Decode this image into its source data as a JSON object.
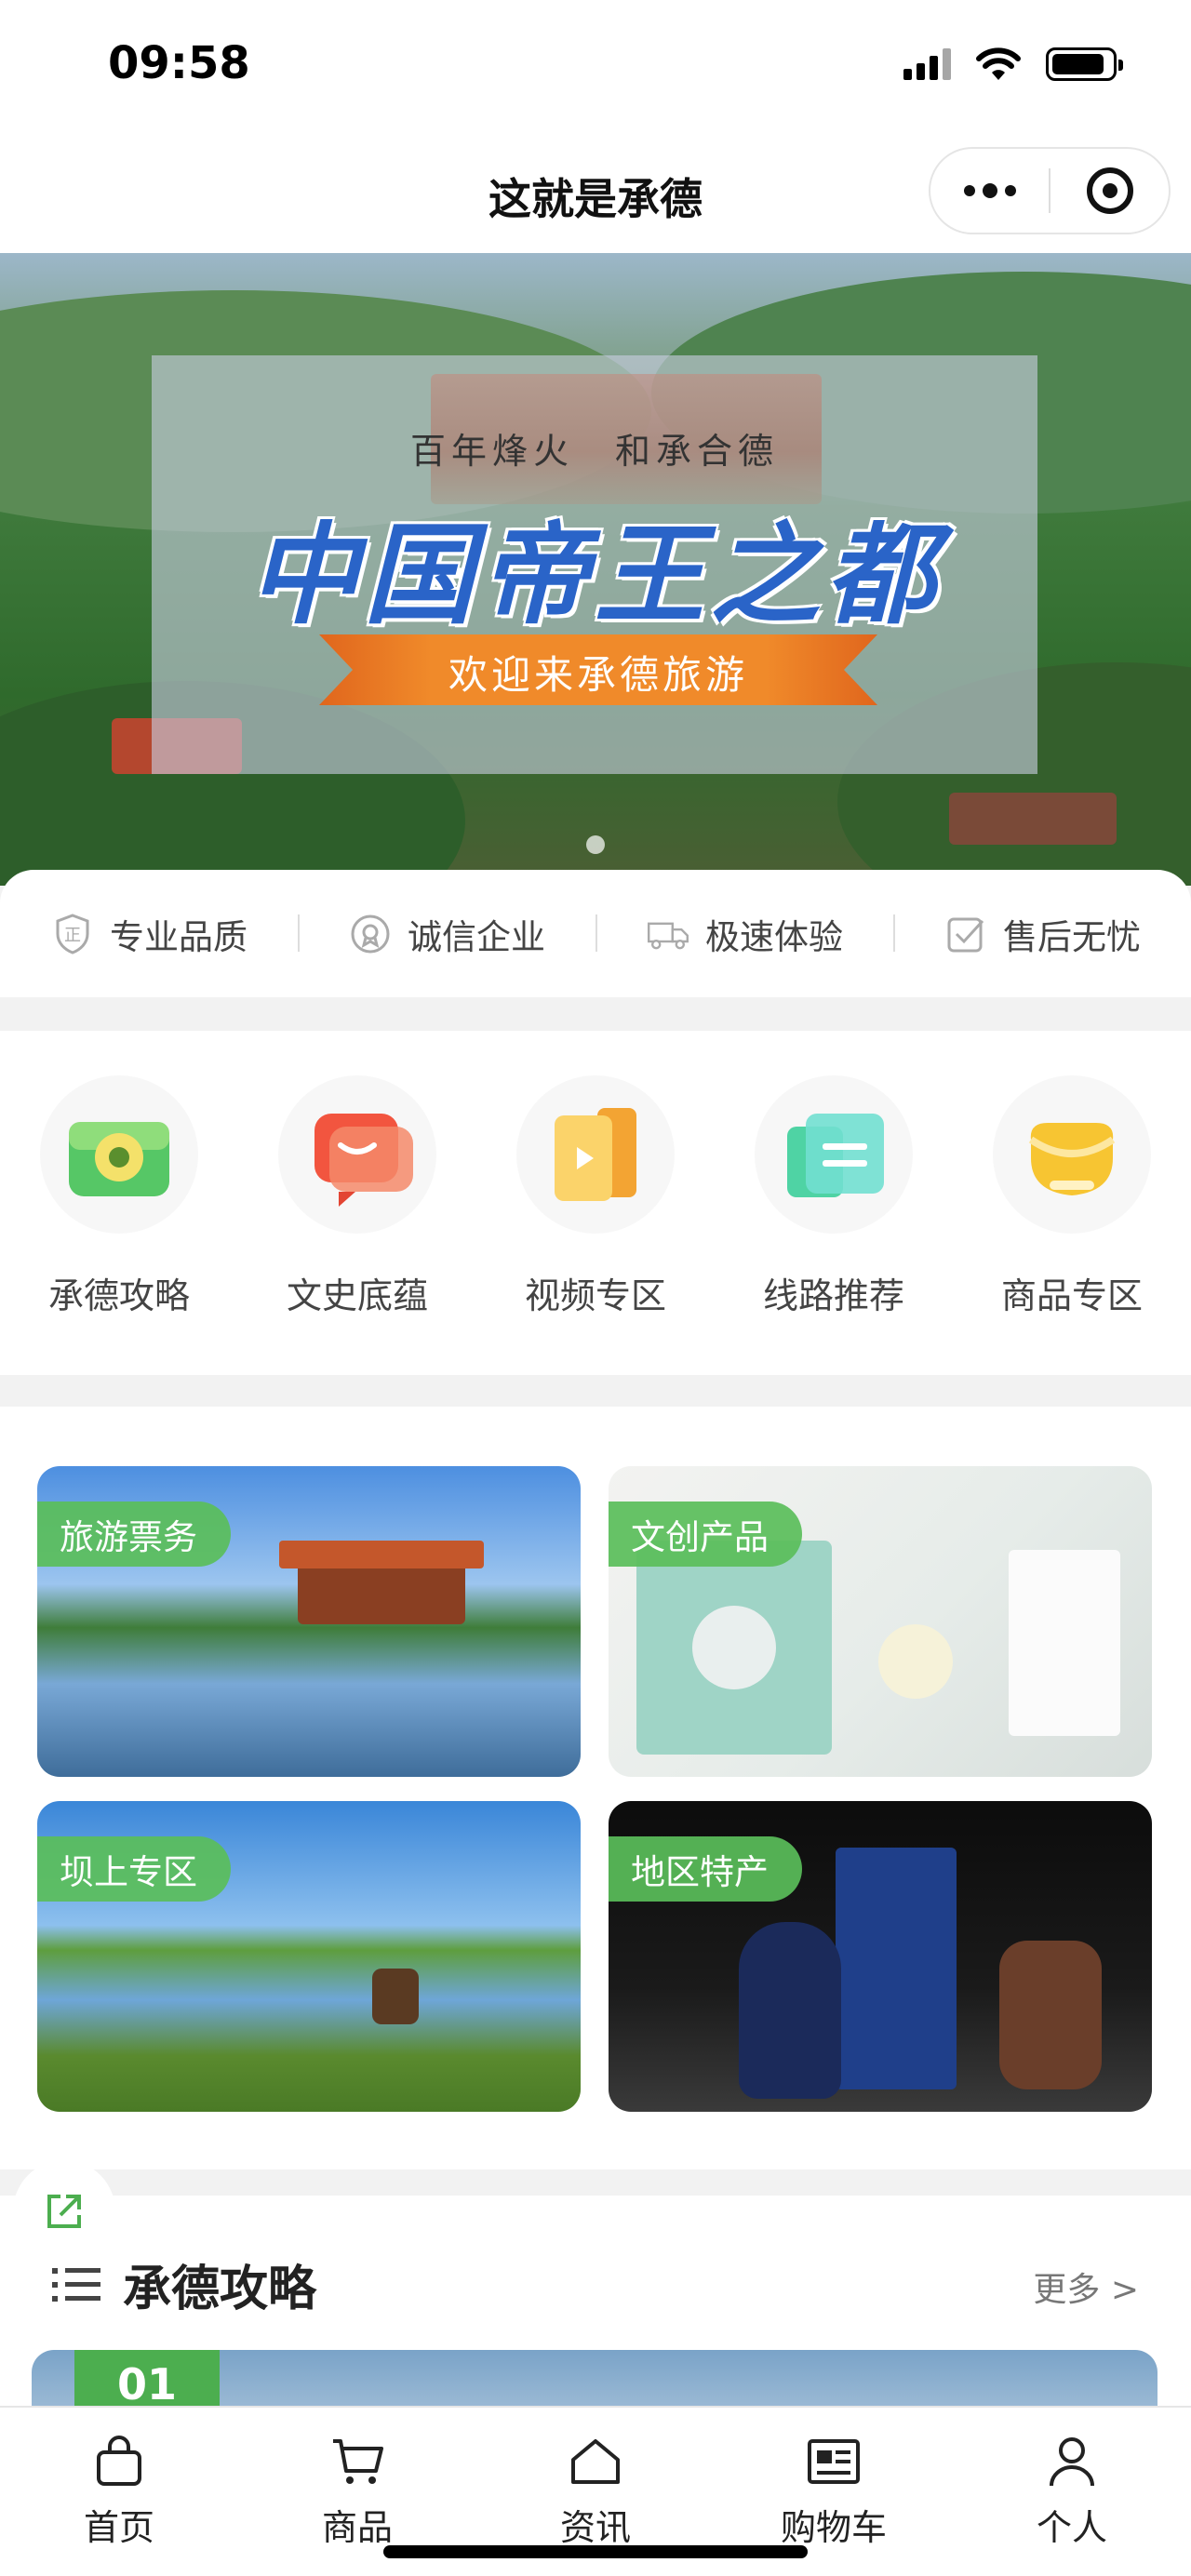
{
  "status_bar": {
    "time": "09:58"
  },
  "nav": {
    "title": "这就是承德"
  },
  "banner": {
    "subtitle": "百年烽火　和承合德",
    "title": "中国帝王之都",
    "ribbon": "欢迎来承德旅游"
  },
  "guarantees": [
    {
      "label": "专业品质",
      "icon": "shield-icon"
    },
    {
      "label": "诚信企业",
      "icon": "badge-icon"
    },
    {
      "label": "极速体验",
      "icon": "truck-icon"
    },
    {
      "label": "售后无忧",
      "icon": "check-icon"
    }
  ],
  "categories": [
    {
      "label": "承德攻略",
      "icon": "camera-icon"
    },
    {
      "label": "文史底蕴",
      "icon": "chat-bubble-icon"
    },
    {
      "label": "视频专区",
      "icon": "video-icon"
    },
    {
      "label": "线路推荐",
      "icon": "route-card-icon"
    },
    {
      "label": "商品专区",
      "icon": "gift-icon"
    }
  ],
  "tiles": [
    {
      "tag": "旅游票务"
    },
    {
      "tag": "文创产品"
    },
    {
      "tag": "坝上专区"
    },
    {
      "tag": "地区特产"
    }
  ],
  "section": {
    "title": "承德攻略",
    "more": "更多 >"
  },
  "article": {
    "number": "01"
  },
  "tabs": [
    {
      "label": "首页",
      "icon": "bag-icon"
    },
    {
      "label": "商品",
      "icon": "cart-icon"
    },
    {
      "label": "资讯",
      "icon": "house-icon"
    },
    {
      "label": "购物车",
      "icon": "newspaper-icon"
    },
    {
      "label": "个人",
      "icon": "person-icon"
    }
  ],
  "colors": {
    "accent": "#4cae4f",
    "title_blue": "#2a64c8",
    "ribbon_orange": "#f08a2a"
  }
}
